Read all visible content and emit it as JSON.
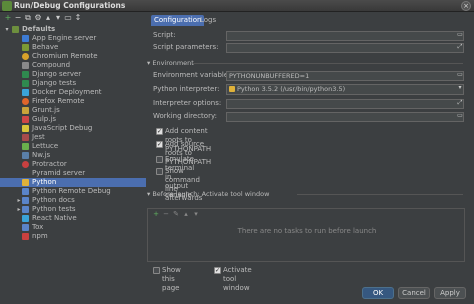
{
  "window": {
    "title": "Run/Debug Configurations"
  },
  "tree": {
    "toolbar_icons": [
      "add-icon",
      "remove-icon",
      "copy-icon",
      "settings-icon",
      "move-up-icon",
      "move-down-icon",
      "folder-icon",
      "sort-icon"
    ],
    "root": "Defaults",
    "items": [
      {
        "label": "App Engine server",
        "color": "#3d7bd4"
      },
      {
        "label": "Behave",
        "color": "#7c9a34"
      },
      {
        "label": "Chromium Remote",
        "color": "#d9a22a"
      },
      {
        "label": "Compound",
        "color": "#8a8a8a"
      },
      {
        "label": "Django server",
        "color": "#2f8a4f"
      },
      {
        "label": "Django tests",
        "color": "#2f8a4f"
      },
      {
        "label": "Docker Deployment",
        "color": "#3aa3d9"
      },
      {
        "label": "Firefox Remote",
        "color": "#e0662b"
      },
      {
        "label": "Grunt.js",
        "color": "#c9a33a"
      },
      {
        "label": "Gulp.js",
        "color": "#cf4646"
      },
      {
        "label": "JavaScript Debug",
        "color": "#d9c43a"
      },
      {
        "label": "Jest",
        "color": "#a84b4b"
      },
      {
        "label": "Lettuce",
        "color": "#6ab04c"
      },
      {
        "label": "Nw.js",
        "color": "#5a7fa8"
      },
      {
        "label": "Protractor",
        "color": "#c94040"
      },
      {
        "label": "Pyramid server",
        "color": ""
      },
      {
        "label": "Python",
        "color": "#e0b23a"
      },
      {
        "label": "Python Remote Debug",
        "color": "#5a84c9"
      },
      {
        "label": "Python docs",
        "color": "#5a84c9"
      },
      {
        "label": "Python tests",
        "color": "#5a84c9"
      },
      {
        "label": "React Native",
        "color": "#3aa3d9"
      },
      {
        "label": "Tox",
        "color": "#5a84c9"
      },
      {
        "label": "npm",
        "color": "#c94040"
      }
    ]
  },
  "tabs": [
    "Configuration",
    "Logs"
  ],
  "form": {
    "script_label": "Script:",
    "script_value": "",
    "script_params_label": "Script parameters:",
    "script_params_value": "",
    "environment_section": "Environment",
    "env_vars_label": "Environment variables:",
    "env_vars_value": "PYTHONUNBUFFERED=1",
    "interpreter_label": "Python interpreter:",
    "interpreter_value": "Python 3.5.2 (/usr/bin/python3.5)",
    "interpreter_options_label": "Interpreter options:",
    "interpreter_options_value": "",
    "working_dir_label": "Working directory:",
    "working_dir_value": "",
    "cb_content_roots": "Add content roots to PYTHONPATH",
    "cb_source_roots": "Add source roots to PYTHONPATH",
    "cb_emulate_terminal": "Emulate terminal in output console",
    "cb_show_cmd": "Show command line afterwards"
  },
  "before_launch": {
    "title": "Before launch: Activate tool window",
    "empty_message": "There are no tasks to run before launch"
  },
  "bottom": {
    "show_page": "Show this page",
    "activate_tool": "Activate tool window"
  },
  "buttons": {
    "ok": "OK",
    "cancel": "Cancel",
    "apply": "Apply"
  }
}
